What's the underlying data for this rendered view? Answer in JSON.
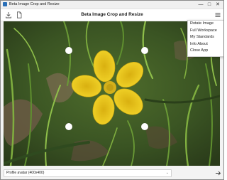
{
  "window": {
    "title": "Beta Image Crop and Resize",
    "controls": {
      "minimize": "—",
      "maximize": "□",
      "close": "✕"
    }
  },
  "toolbar": {
    "heading": "Beta Image Crop and Resize",
    "icons": [
      "download-icon",
      "document-icon",
      "hamburger-menu-icon"
    ]
  },
  "menu": {
    "items": [
      "Rotate Image",
      "Full Workspace",
      "My Standards",
      "Info About",
      "Close App"
    ]
  },
  "image": {
    "subject": "yellow flower on grass",
    "crop_handles": [
      "top-left",
      "top-right",
      "bottom-left",
      "bottom-right"
    ]
  },
  "status": {
    "select_value": "Profile avatar (400x400)",
    "chevron": "⌄"
  },
  "colors": {
    "flower": "#f0cf1c",
    "grass_dark": "#2f4a1f",
    "grass_light": "#8fbf4a"
  }
}
